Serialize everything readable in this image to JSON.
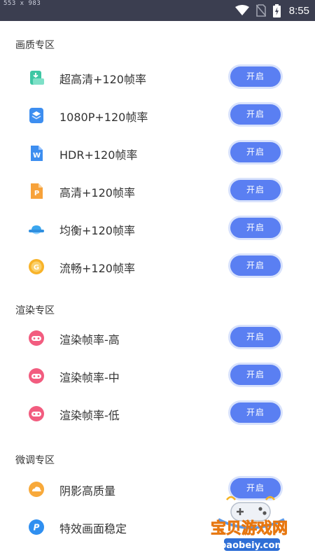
{
  "status_bar": {
    "dimensions_text": "553 x 983",
    "time": "8:55"
  },
  "sections": [
    {
      "title": "画质专区",
      "items": [
        {
          "label": "超高清+120帧率",
          "icon": "teal-download-icon",
          "button": "开启"
        },
        {
          "label": "1080P+120帧率",
          "icon": "blue-layers-icon",
          "button": "开启"
        },
        {
          "label": "HDR+120帧率",
          "icon": "blue-w-document-icon",
          "button": "开启"
        },
        {
          "label": "高清+120帧率",
          "icon": "orange-p-document-icon",
          "button": "开启"
        },
        {
          "label": "均衡+120帧率",
          "icon": "blue-cloud-icon",
          "button": "开启"
        },
        {
          "label": "流畅+120帧率",
          "icon": "orange-g-circle-icon",
          "button": "开启"
        }
      ]
    },
    {
      "title": "渲染专区",
      "items": [
        {
          "label": "渲染帧率-高",
          "icon": "pink-gamepad-icon",
          "button": "开启"
        },
        {
          "label": "渲染帧率-中",
          "icon": "pink-gamepad-icon",
          "button": "开启"
        },
        {
          "label": "渲染帧率-低",
          "icon": "pink-gamepad-icon",
          "button": "开启"
        }
      ]
    },
    {
      "title": "微调专区",
      "items": [
        {
          "label": "阴影高质量",
          "icon": "orange-cloud-circle-icon",
          "button": "开启"
        },
        {
          "label": "特效画面稳定",
          "icon": "blue-p-circle-icon",
          "button": ""
        }
      ]
    }
  ],
  "watermark": {
    "brand": "宝贝游戏网",
    "domain": "baobeiy.com"
  },
  "colors": {
    "status_bar": "#3b3e50",
    "button": "#5a7ff2",
    "button_ring": "#d8e2fc"
  }
}
